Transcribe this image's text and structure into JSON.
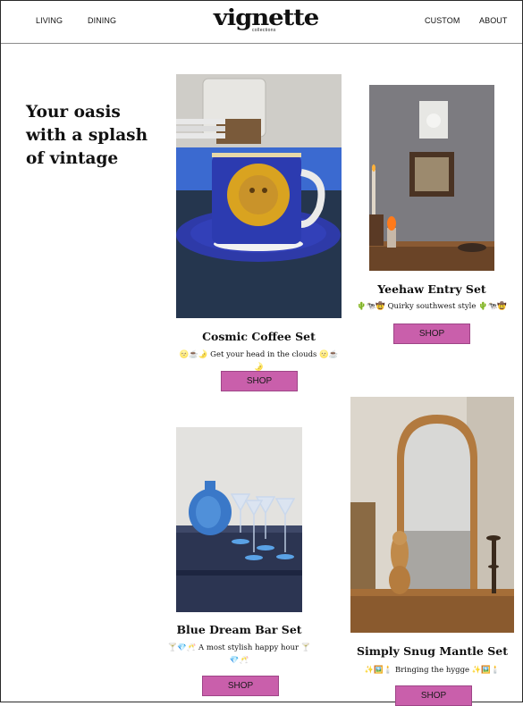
{
  "nav": {
    "left": [
      "LIVING",
      "DINING"
    ],
    "right": [
      "CUSTOM",
      "ABOUT"
    ],
    "logo": "vignette",
    "logo_sub": "collections"
  },
  "tagline": "Your oasis with a splash of vintage",
  "products": [
    {
      "title": "Cosmic Coffee Set",
      "desc": "🌝☕🌛 Get your head in the clouds 🌝☕🌛",
      "button": "SHOP"
    },
    {
      "title": "Yeehaw Entry Set",
      "desc": "🌵🐄🤠 Quirky southwest style 🌵🐄🤠",
      "button": "SHOP"
    },
    {
      "title": "Blue Dream Bar Set",
      "desc": "🍸💎🥂 A most stylish happy hour 🍸💎🥂",
      "button": "SHOP"
    },
    {
      "title": "Simply Snug Mantle Set",
      "desc": "✨🖼️🕯️ Bringing the hygge ✨🖼️🕯️",
      "button": "SHOP"
    }
  ],
  "colors": {
    "button": "#c95fab",
    "border": "#8c8c8c"
  }
}
